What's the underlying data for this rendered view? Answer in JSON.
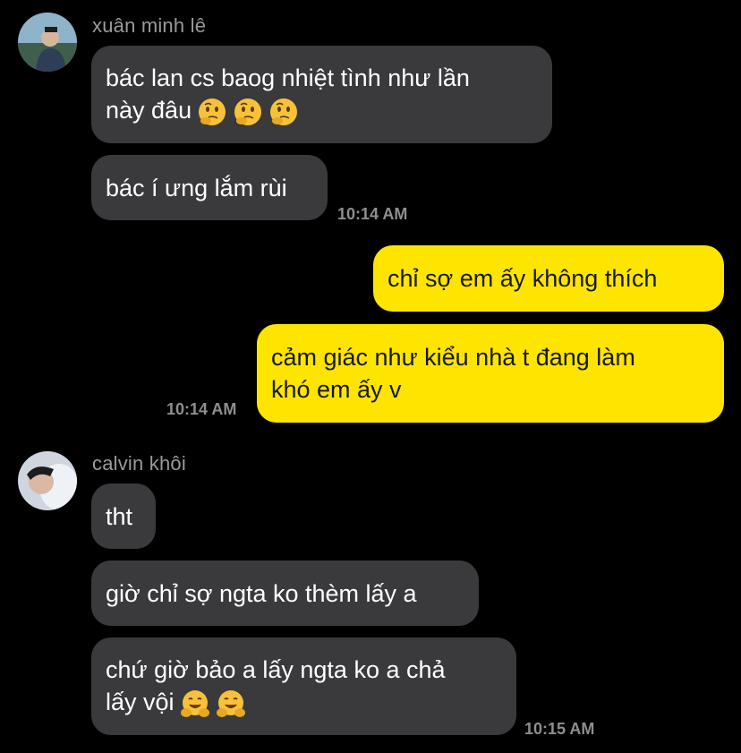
{
  "colors": {
    "background": "#000000",
    "incoming_bubble": "#3a3a3c",
    "outgoing_bubble": "#fde500",
    "timestamp": "#8e8e8e",
    "sender_name": "#9a9a9a"
  },
  "conversation": [
    {
      "sender": "xuân minh lê",
      "avatar_icon": "user-avatar-photo",
      "messages": [
        {
          "text": "bác lan cs baog nhiệt tình như lần\nnày đâu",
          "emojis": [
            "thinking-face-emoji",
            "thinking-face-emoji",
            "thinking-face-emoji"
          ]
        },
        {
          "text": "bác í ưng lắm rùi"
        }
      ],
      "time": "10:14 AM"
    },
    {
      "sender": "me",
      "messages": [
        {
          "text": "chỉ sợ em ấy không thích"
        },
        {
          "text": "cảm giác như kiểu nhà t đang làm\nkhó em ấy v"
        }
      ],
      "time": "10:14 AM"
    },
    {
      "sender": "calvin khôi",
      "avatar_icon": "user-avatar-photo",
      "messages": [
        {
          "text": "tht"
        },
        {
          "text": "giờ chỉ sợ ngta ko thèm lấy a"
        },
        {
          "text": "chứ giờ bảo a lấy ngta ko a chả\nlấy vội",
          "emojis": [
            "hugging-face-emoji",
            "hugging-face-emoji"
          ]
        }
      ],
      "time": "10:15 AM"
    }
  ]
}
